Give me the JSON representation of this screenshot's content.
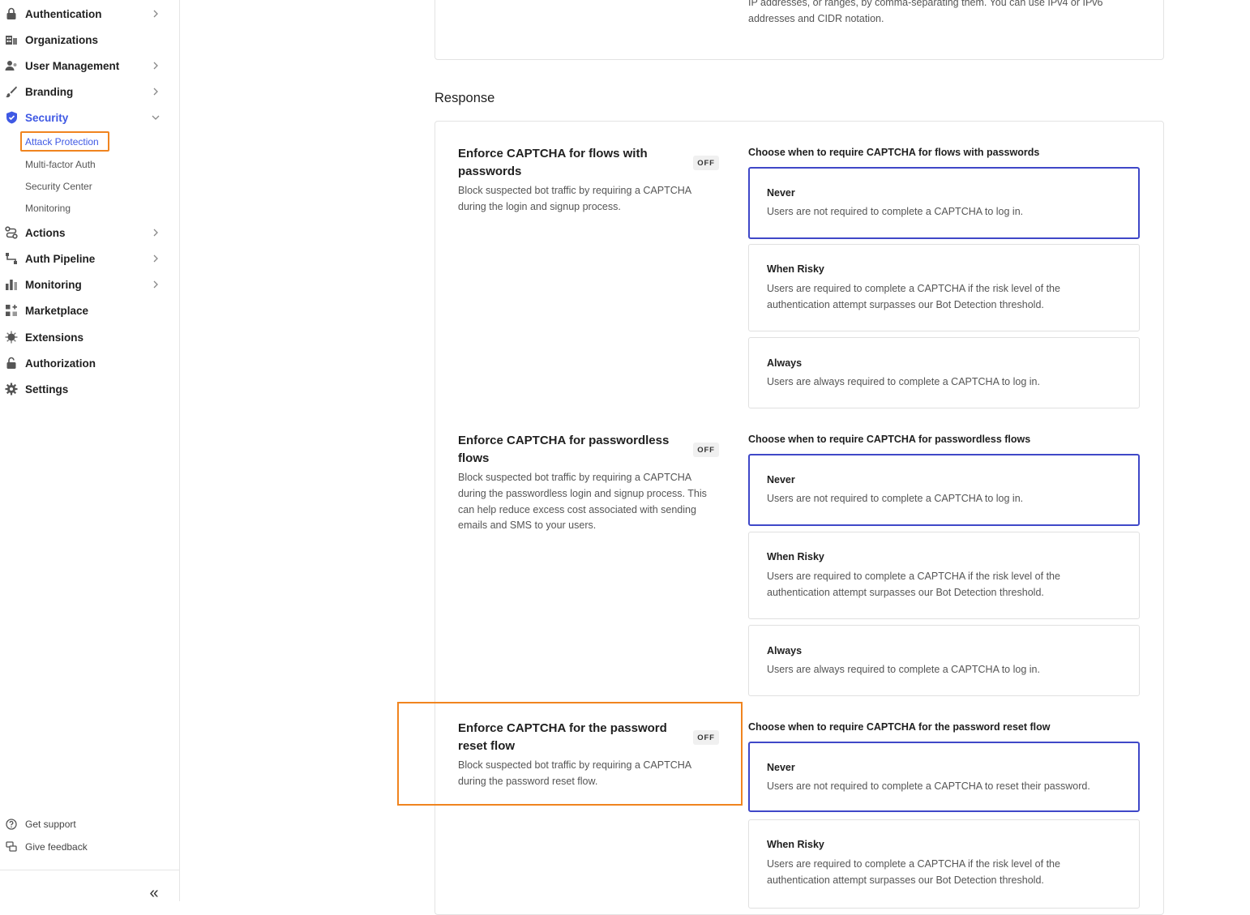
{
  "sidebar": {
    "items": [
      {
        "label": "Authentication",
        "icon": "lock-icon",
        "chevron": "right"
      },
      {
        "label": "Organizations",
        "icon": "building-icon",
        "chevron": ""
      },
      {
        "label": "User Management",
        "icon": "users-icon",
        "chevron": "right"
      },
      {
        "label": "Branding",
        "icon": "brush-icon",
        "chevron": "right"
      },
      {
        "label": "Security",
        "icon": "shield-check-icon",
        "chevron": "down",
        "active": true
      },
      {
        "label": "Actions",
        "icon": "actions-icon",
        "chevron": "right"
      },
      {
        "label": "Auth Pipeline",
        "icon": "pipeline-icon",
        "chevron": "right"
      },
      {
        "label": "Monitoring",
        "icon": "bar-chart-icon",
        "chevron": "right"
      },
      {
        "label": "Marketplace",
        "icon": "marketplace-icon",
        "chevron": ""
      },
      {
        "label": "Extensions",
        "icon": "extensions-icon",
        "chevron": ""
      },
      {
        "label": "Authorization",
        "icon": "unlock-icon",
        "chevron": ""
      },
      {
        "label": "Settings",
        "icon": "gear-icon",
        "chevron": ""
      }
    ],
    "security_sub": [
      "Attack Protection",
      "Multi-factor Auth",
      "Security Center",
      "Monitoring"
    ],
    "footer": [
      {
        "label": "Get support",
        "icon": "help-circle-icon"
      },
      {
        "label": "Give feedback",
        "icon": "feedback-icon"
      }
    ],
    "collapse_label": "«"
  },
  "main": {
    "top_text": "IP addresses, or ranges, by comma-separating them. You can use IPv4 or IPv6 addresses and CIDR notation.",
    "section_title": "Response",
    "features": [
      {
        "title": "Enforce CAPTCHA for flows with passwords",
        "badge": "OFF",
        "desc": "Block suspected bot traffic by requiring a CAPTCHA during the login and signup process.",
        "choose_label": "Choose when to require CAPTCHA for flows with passwords",
        "options": [
          {
            "title": "Never",
            "desc": "Users are not required to complete a CAPTCHA to log in.",
            "selected": true
          },
          {
            "title": "When Risky",
            "desc": "Users are required to complete a CAPTCHA if the risk level of the authentication attempt surpasses our Bot Detection threshold."
          },
          {
            "title": "Always",
            "desc": "Users are always required to complete a CAPTCHA to log in."
          }
        ]
      },
      {
        "title": "Enforce CAPTCHA for passwordless flows",
        "badge": "OFF",
        "desc": "Block suspected bot traffic by requiring a CAPTCHA during the passwordless login and signup process. This can help reduce excess cost associated with sending emails and SMS to your users.",
        "choose_label": "Choose when to require CAPTCHA for passwordless flows",
        "options": [
          {
            "title": "Never",
            "desc": "Users are not required to complete a CAPTCHA to log in.",
            "selected": true
          },
          {
            "title": "When Risky",
            "desc": "Users are required to complete a CAPTCHA if the risk level of the authentication attempt surpasses our Bot Detection threshold."
          },
          {
            "title": "Always",
            "desc": "Users are always required to complete a CAPTCHA to log in."
          }
        ]
      },
      {
        "title": "Enforce CAPTCHA for the password reset flow",
        "badge": "OFF",
        "desc": "Block suspected bot traffic by requiring a CAPTCHA during the password reset flow.",
        "choose_label": "Choose when to require CAPTCHA for the password reset flow",
        "options": [
          {
            "title": "Never",
            "desc": "Users are not required to complete a CAPTCHA to reset their password.",
            "selected": true
          },
          {
            "title": "When Risky",
            "desc": "Users are required to complete a CAPTCHA if the risk level of the authentication attempt surpasses our Bot Detection threshold."
          }
        ]
      }
    ]
  },
  "colors": {
    "accent": "#3f59e4",
    "selected_border": "#3f48c8",
    "highlight": "#f0841f"
  }
}
